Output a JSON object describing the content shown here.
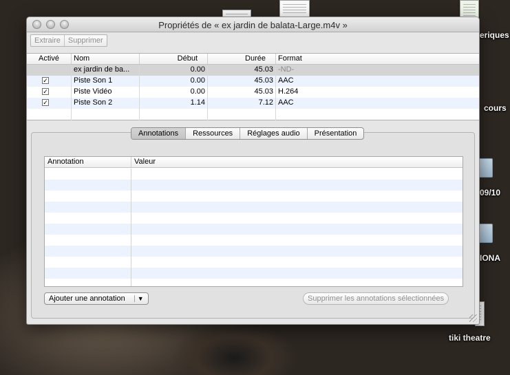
{
  "window": {
    "title": "Propriétés de « ex jardin de balata-Large.m4v »"
  },
  "toolbar": {
    "extract_label": "Extraire",
    "delete_label": "Supprimer"
  },
  "tracks": {
    "columns": [
      "Activé",
      "Nom",
      "Début",
      "Durée",
      "Format"
    ],
    "rows": [
      {
        "active": false,
        "name": "ex jardin de ba...",
        "start": "0.00",
        "duration": "45.03",
        "format": "-ND-"
      },
      {
        "active": true,
        "name": "Piste Son 1",
        "start": "0.00",
        "duration": "45.03",
        "format": "AAC"
      },
      {
        "active": true,
        "name": "Piste Vidéo",
        "start": "0.00",
        "duration": "45.03",
        "format": "H.264"
      },
      {
        "active": true,
        "name": "Piste Son 2",
        "start": "1.14",
        "duration": "7.12",
        "format": "AAC"
      }
    ]
  },
  "tabs": {
    "items": [
      "Annotations",
      "Ressources",
      "Réglages audio",
      "Présentation"
    ],
    "active": "Annotations"
  },
  "annotations": {
    "columns": [
      "Annotation",
      "Valeur"
    ],
    "add_label": "Ajouter une annotation",
    "delete_selected_label": "Supprimer les annotations sélectionnées"
  },
  "desktop": {
    "labels": [
      "eriques",
      "cours",
      "09/10",
      "IONA",
      "tiki theatre"
    ]
  },
  "icons": {
    "checkbox": "checkbox-checked-icon",
    "dropdown": "chevron-down-icon",
    "resize": "resize-grip-icon"
  }
}
